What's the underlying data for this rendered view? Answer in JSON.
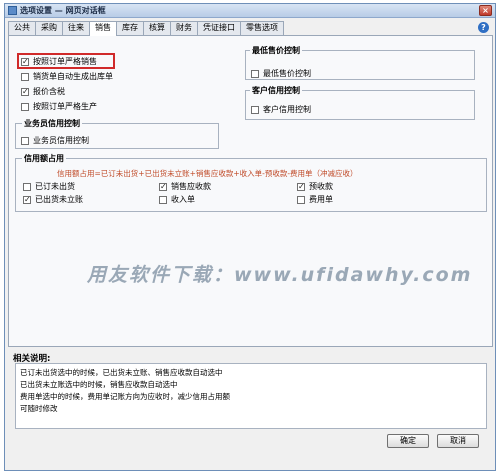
{
  "window": {
    "title": "选项设置 — 网页对话框",
    "close_label": "×"
  },
  "tabs": [
    "公共",
    "采购",
    "往来",
    "销售",
    "库存",
    "核算",
    "财务",
    "凭证接口",
    "零售选项"
  ],
  "active_tab": "销售",
  "help_label": "?",
  "options": {
    "strict_sales_by_order": {
      "label": "按照订单严格销售",
      "checked": true
    },
    "auto_generate_outbound": {
      "label": "销货单自动生成出库单",
      "checked": false
    },
    "price_includes_tax": {
      "label": "报价含税",
      "checked": true
    },
    "strict_production_by_order": {
      "label": "按照订单严格生产",
      "checked": false
    }
  },
  "min_price_group": {
    "title": "最低售价控制",
    "option": {
      "label": "最低售价控制",
      "checked": false
    }
  },
  "customer_credit_group": {
    "title": "客户信用控制",
    "option": {
      "label": "客户信用控制",
      "checked": false
    }
  },
  "salesperson_credit_group": {
    "title": "业务员信用控制",
    "option": {
      "label": "业务员信用控制",
      "checked": false
    }
  },
  "credit_usage_group": {
    "title": "信用额占用",
    "formula": "信用额占用=已订未出货+已出货未立账+销售应收款+收入单-预收款-费用单（冲减应收）",
    "items": [
      {
        "label": "已订未出货",
        "checked": false
      },
      {
        "label": "销售应收款",
        "checked": true
      },
      {
        "label": "预收款",
        "checked": true
      },
      {
        "label": "已出货未立账",
        "checked": true
      },
      {
        "label": "收入单",
        "checked": false
      },
      {
        "label": "费用单",
        "checked": false
      }
    ]
  },
  "watermark": "用友软件下载：www.ufidawhy.com",
  "notes": {
    "label": "相关说明:",
    "lines": [
      "已订未出货选中的时候，已出货未立账、销售应收款自动选中",
      "已出货未立账选中的时候，销售应收款自动选中",
      "费用单选中的时候，费用单记账方向为应收时，减少信用占用额",
      "可随时修改"
    ]
  },
  "buttons": {
    "ok": "确定",
    "cancel": "取消"
  }
}
